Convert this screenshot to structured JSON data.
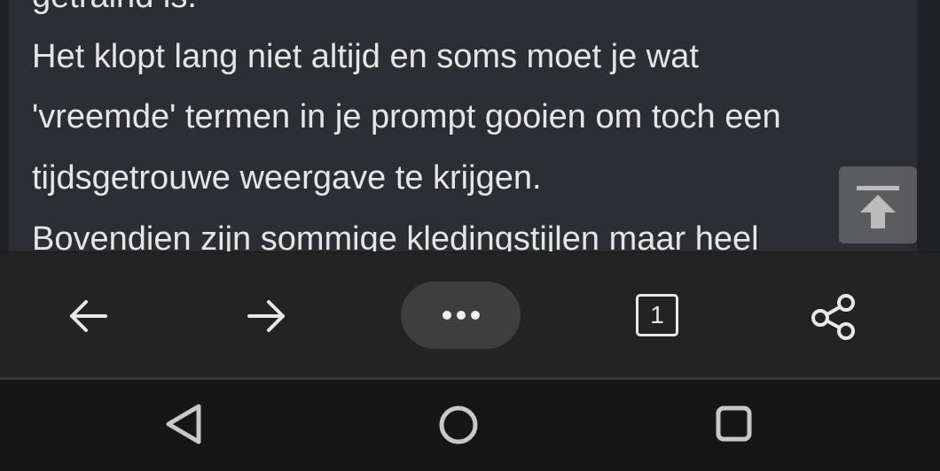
{
  "article": {
    "lines": [
      "getraind is.",
      "Het klopt lang niet altijd en soms moet je wat",
      "'vreemde' termen in je prompt gooien om toch een",
      "tijdsgetrouwe weergave te krijgen.",
      "Bovendien zijn sommige kledingstijlen maar heel"
    ]
  },
  "scroll_top": {
    "icon": "arrow-to-top-icon"
  },
  "toolbar": {
    "back_icon": "arrow-left-icon",
    "forward_icon": "arrow-right-icon",
    "menu_icon": "more-horizontal-icon",
    "tab_count": "1",
    "share_icon": "share-icon"
  },
  "navbar": {
    "back_icon": "triangle-back-icon",
    "home_icon": "circle-home-icon",
    "recents_icon": "square-recents-icon"
  },
  "colors": {
    "card_bg": "#2b2e33",
    "text": "#e6e6e6",
    "toolbar_bg": "#232323",
    "navbar_bg": "#161617",
    "menu_pill": "#3e3e3e"
  }
}
